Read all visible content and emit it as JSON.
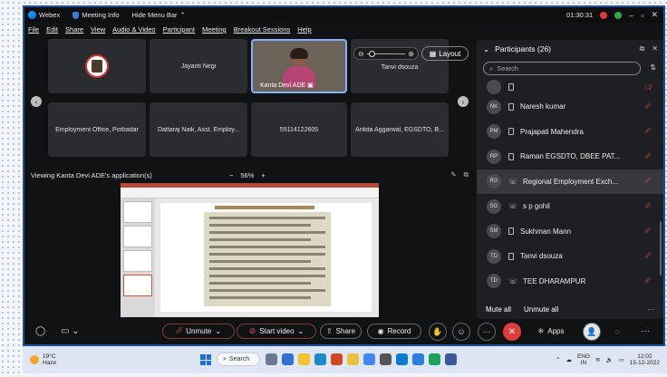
{
  "titlebar": {
    "app_name": "Webex",
    "meeting_info": "Meeting Info",
    "hide_menu": "Hide Menu Bar",
    "timer": "01:30:31"
  },
  "menu": [
    "File",
    "Edit",
    "Share",
    "View",
    "Audio & Video",
    "Participant",
    "Meeting",
    "Breakout Sessions",
    "Help"
  ],
  "video_tiles": {
    "tile1_name": "",
    "tile2_name": "Jayanti Negi",
    "tile3_name": "Kanta Devi ADE",
    "tile4_name": "Tanvi dsouza",
    "tile5_name": "Employment Office, Porbadar",
    "tile6_name": "Dattaraj Naik, Asst. Employ...",
    "tile7_name": "55114122605",
    "tile8_name": "Ankita Aggarwal, EGSDTO, B..."
  },
  "layout_label": "Layout",
  "viewing": {
    "label": "Viewing Kanta Devi ADE's application(s)",
    "zoom": "56%",
    "minus": "−",
    "plus": "+"
  },
  "participants": {
    "header": "Participants (26)",
    "search_placeholder": "Search",
    "mute_all": "Mute all",
    "unmute_all": "Unmute all",
    "items": [
      {
        "initials": "",
        "name": ""
      },
      {
        "initials": "NK",
        "name": "Naresh kumar"
      },
      {
        "initials": "PM",
        "name": "Prajapati Mahendra"
      },
      {
        "initials": "RP",
        "name": "Raman EGSDTO, DBEE PAT..."
      },
      {
        "initials": "RG",
        "name": "Regional Employment Exch..."
      },
      {
        "initials": "SG",
        "name": "s p gohil"
      },
      {
        "initials": "SM",
        "name": "Sukhman Mann"
      },
      {
        "initials": "TD",
        "name": "Tanvi dsouza"
      },
      {
        "initials": "TD",
        "name": "TEE DHARAMPUR"
      }
    ]
  },
  "toolbar": {
    "unmute": "Unmute",
    "start_video": "Start video",
    "share": "Share",
    "record": "Record",
    "apps": "Apps"
  },
  "taskbar": {
    "temp": "19°C",
    "weather": "Haze",
    "search": "Search",
    "lang1": "ENG",
    "lang2": "IN",
    "time": "12:02",
    "date": "15-12-2022"
  },
  "colors": {
    "end_call": "#e23b3b",
    "frame_border": "#1d4f9a",
    "muted_icon": "#e55555"
  }
}
